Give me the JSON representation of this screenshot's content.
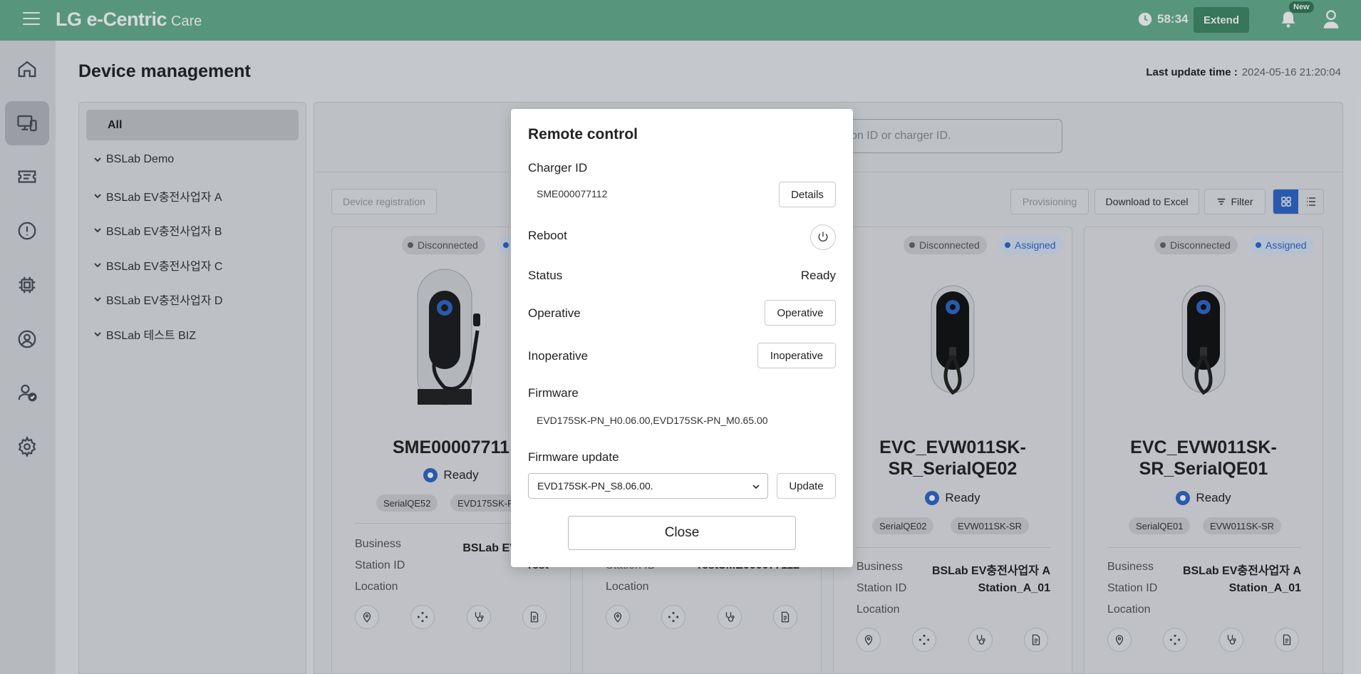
{
  "header": {
    "brand_main": "LG e-Centric",
    "brand_sub": "Care",
    "timer": "58:34",
    "extend_label": "Extend",
    "new_badge": "New"
  },
  "page": {
    "title": "Device management",
    "last_update_label": "Last update time :",
    "last_update_value": "2024-05-16 21:20:04"
  },
  "tree": {
    "all_label": "All",
    "items": [
      "BSLab Demo",
      "BSLab EV충전사업자 A",
      "BSLab EV충전사업자 B",
      "BSLab EV충전사업자 C",
      "BSLab EV충전사업자 D",
      "BSLab 테스트 BIZ"
    ]
  },
  "search": {
    "placeholder": "tion ID or charger ID."
  },
  "toolbar": {
    "device_registration": "Device registration",
    "provisioning": "Provisioning",
    "download_excel": "Download to Excel",
    "filter": "Filter"
  },
  "cards": [
    {
      "badge_conn": "Disconnected",
      "name": "SME00007711",
      "status": "Ready",
      "tag1": "SerialQE52",
      "tag2": "EVD175SK-P",
      "business_label": "Business",
      "business": "BSLab EV충전사",
      "station_label": "Station ID",
      "station": "Test",
      "location_label": "Location"
    },
    {
      "station_label": "Station ID",
      "station": "TestSME000077112",
      "location_label": "Location"
    },
    {
      "badge_conn": "Disconnected",
      "badge_assign": "Assigned",
      "name_line1": "EVC_EVW011SK-",
      "name_line2": "SR_SerialQE02",
      "status": "Ready",
      "tag1": "SerialQE02",
      "tag2": "EVW011SK-SR",
      "business_label": "Business",
      "business": "BSLab EV충전사업자 A",
      "station_label": "Station ID",
      "station": "Station_A_01",
      "location_label": "Location"
    },
    {
      "badge_conn": "Disconnected",
      "badge_assign": "Assigned",
      "name_line1": "EVC_EVW011SK-",
      "name_line2": "SR_SerialQE01",
      "status": "Ready",
      "tag1": "SerialQE01",
      "tag2": "EVW011SK-SR",
      "business_label": "Business",
      "business": "BSLab EV충전사업자 A",
      "station_label": "Station ID",
      "station": "Station_A_01",
      "location_label": "Location"
    }
  ],
  "modal": {
    "title": "Remote control",
    "charger_id_label": "Charger ID",
    "charger_id": "SME000077112",
    "details_label": "Details",
    "reboot_label": "Reboot",
    "status_label": "Status",
    "status_value": "Ready",
    "operative_label": "Operative",
    "operative_button": "Operative",
    "inoperative_label": "Inoperative",
    "inoperative_button": "Inoperative",
    "firmware_label": "Firmware",
    "firmware_value": "EVD175SK-PN_H0.06.00,EVD175SK-PN_M0.65.00",
    "firmware_update_label": "Firmware update",
    "firmware_update_selected": "EVD175SK-PN_S8.06.00.",
    "update_button": "Update",
    "close_button": "Close"
  },
  "colors": {
    "header_bg": "#66b08f",
    "accent_blue": "#2f68c9",
    "extend_bg": "#3f8a67"
  }
}
